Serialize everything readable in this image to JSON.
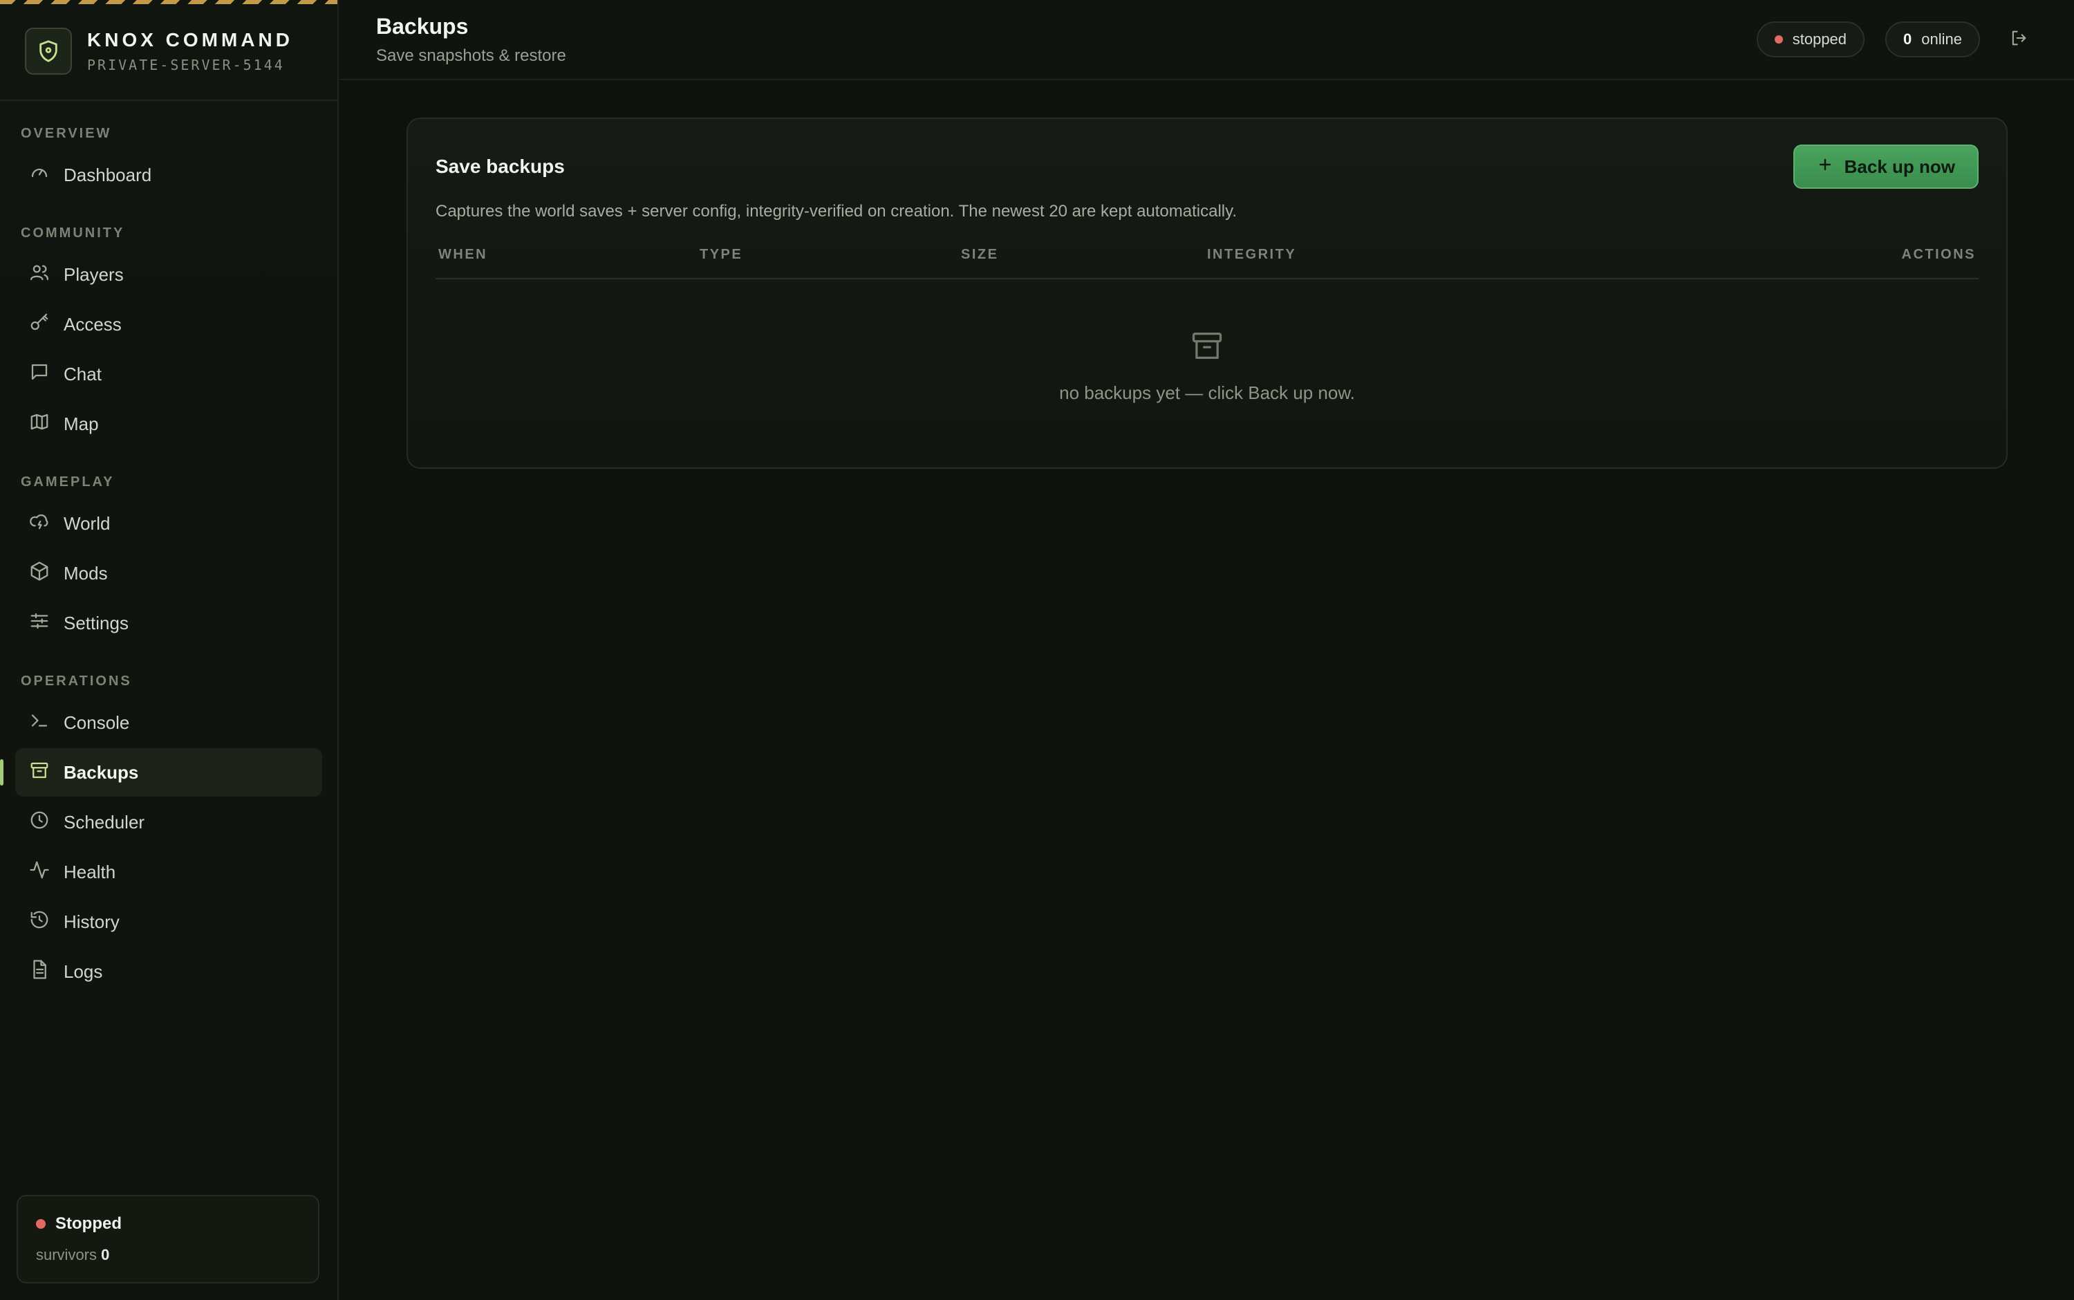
{
  "brand": {
    "title": "KNOX COMMAND",
    "subtitle": "PRIVATE-SERVER-5144"
  },
  "sidebar": {
    "sections": [
      {
        "label": "OVERVIEW",
        "items": [
          {
            "label": "Dashboard",
            "icon": "gauge-icon"
          }
        ]
      },
      {
        "label": "COMMUNITY",
        "items": [
          {
            "label": "Players",
            "icon": "users-icon"
          },
          {
            "label": "Access",
            "icon": "key-icon"
          },
          {
            "label": "Chat",
            "icon": "chat-icon"
          },
          {
            "label": "Map",
            "icon": "map-icon"
          }
        ]
      },
      {
        "label": "GAMEPLAY",
        "items": [
          {
            "label": "World",
            "icon": "cloud-lightning-icon"
          },
          {
            "label": "Mods",
            "icon": "box-icon"
          },
          {
            "label": "Settings",
            "icon": "sliders-icon"
          }
        ]
      },
      {
        "label": "OPERATIONS",
        "items": [
          {
            "label": "Console",
            "icon": "terminal-icon"
          },
          {
            "label": "Backups",
            "icon": "archive-icon",
            "active": true
          },
          {
            "label": "Scheduler",
            "icon": "clock-icon"
          },
          {
            "label": "Health",
            "icon": "activity-icon"
          },
          {
            "label": "History",
            "icon": "history-icon"
          },
          {
            "label": "Logs",
            "icon": "file-text-icon"
          }
        ]
      }
    ],
    "status": {
      "label": "Stopped",
      "survivors_label": "survivors",
      "survivors_count": "0",
      "color": "#e26a63"
    }
  },
  "header": {
    "title": "Backups",
    "subtitle": "Save snapshots & restore",
    "status_pill": "stopped",
    "online_count": "0",
    "online_label": "online"
  },
  "card": {
    "title": "Save backups",
    "button_label": "Back up now",
    "description": "Captures the world saves + server config, integrity-verified on creation. The newest 20 are kept automatically.",
    "columns": [
      "WHEN",
      "TYPE",
      "SIZE",
      "INTEGRITY",
      "ACTIONS"
    ],
    "empty_text": "no backups yet — click Back up now."
  },
  "colors": {
    "accent": "#a7c97a",
    "primary_button": "#49a35d",
    "status_stopped": "#e26a63"
  }
}
